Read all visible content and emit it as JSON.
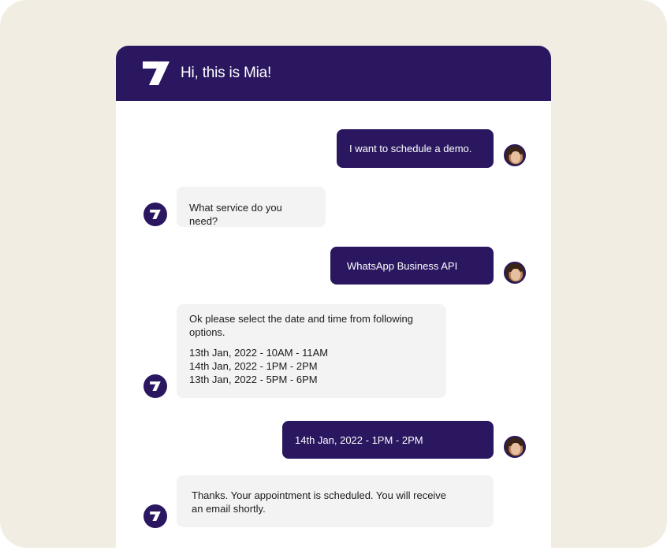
{
  "header": {
    "title": "Hi, this is Mia!",
    "logo_icon": "brand-logo-icon"
  },
  "colors": {
    "brand": "#2a1760",
    "backdrop": "#f1ede3",
    "bot_bubble": "#f3f3f3",
    "panel": "#ffffff"
  },
  "messages": [
    {
      "sender": "user",
      "text": "I want to schedule a demo."
    },
    {
      "sender": "bot",
      "text": "What service do you need?"
    },
    {
      "sender": "user",
      "text": "WhatsApp Business API"
    },
    {
      "sender": "bot",
      "text": "Ok please select the date and time from following options.",
      "options": [
        "13th Jan, 2022 - 10AM - 11AM",
        "14th Jan, 2022 - 1PM - 2PM",
        "13th Jan, 2022 - 5PM - 6PM"
      ]
    },
    {
      "sender": "user",
      "text": "14th Jan, 2022 - 1PM - 2PM"
    },
    {
      "sender": "bot",
      "text": "Thanks. Your appointment is scheduled. You will receive an email shortly."
    }
  ]
}
